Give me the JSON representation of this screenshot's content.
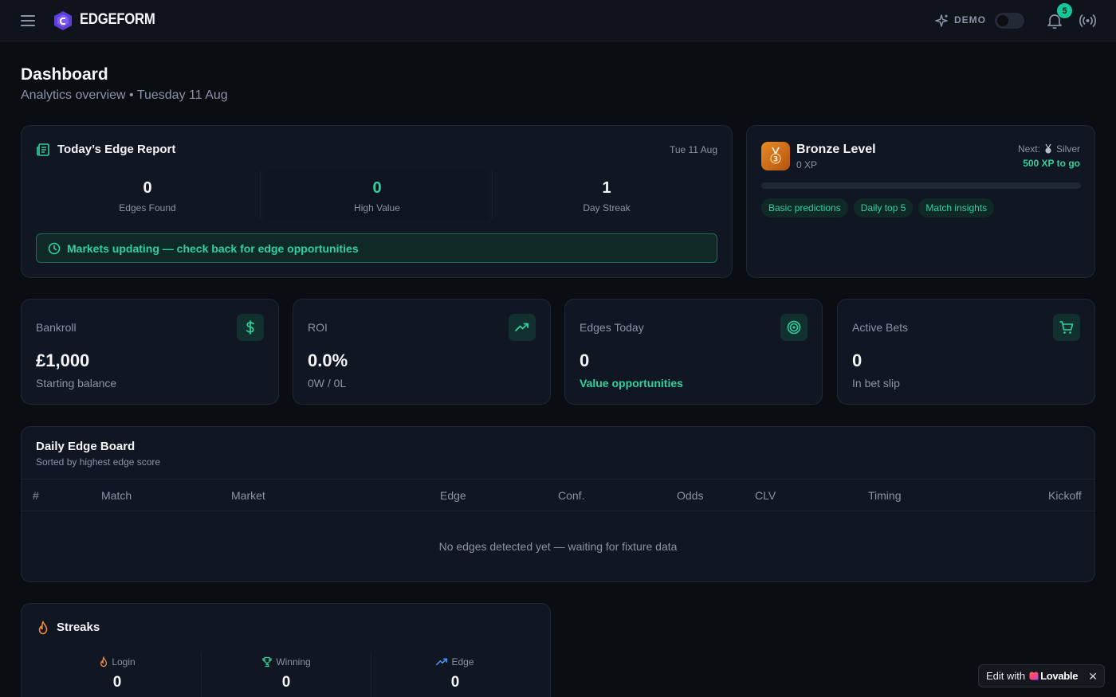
{
  "app": {
    "brand": "EDGEFORM",
    "demo_label": "DEMO",
    "notification_count": "5"
  },
  "header": {
    "title": "Dashboard",
    "subtitle": "Analytics overview • Tuesday 11 Aug"
  },
  "edge_report": {
    "title": "Today’s Edge Report",
    "date": "Tue 11 Aug",
    "stats": [
      {
        "value": "0",
        "label": "Edges Found"
      },
      {
        "value": "0",
        "label": "High Value"
      },
      {
        "value": "1",
        "label": "Day Streak"
      }
    ],
    "banner": "Markets updating — check back for edge opportunities"
  },
  "level": {
    "title": "Bronze Level",
    "xp": "0 XP",
    "next_label": "Next:",
    "next_name": "Silver",
    "to_go": "500 XP to go",
    "progress_fraction": 0,
    "perks": [
      "Basic predictions",
      "Daily top 5",
      "Match insights"
    ]
  },
  "stats": [
    {
      "label": "Bankroll",
      "value": "£1,000",
      "sub": "Starting balance",
      "icon": "dollar-icon"
    },
    {
      "label": "ROI",
      "value": "0.0%",
      "sub": "0W / 0L",
      "icon": "trending-up-icon"
    },
    {
      "label": "Edges Today",
      "value": "0",
      "sub": "Value opportunities",
      "icon": "target-icon"
    },
    {
      "label": "Active Bets",
      "value": "0",
      "sub": "In bet slip",
      "icon": "cart-icon"
    }
  ],
  "board": {
    "title": "Daily Edge Board",
    "subtitle": "Sorted by highest edge score",
    "columns": [
      "#",
      "Match",
      "Market",
      "Edge",
      "Conf.",
      "Odds",
      "CLV",
      "Timing",
      "Kickoff"
    ],
    "empty": "No edges detected yet — waiting for fixture data"
  },
  "streaks": {
    "title": "Streaks",
    "items": [
      {
        "label": "Login",
        "value": "0"
      },
      {
        "label": "Winning",
        "value": "0"
      },
      {
        "label": "Edge",
        "value": "0"
      }
    ]
  },
  "lovable": {
    "edit": "Edit with",
    "brand": "Lovable",
    "close": "✕"
  },
  "colors": {
    "accent": "#2fd19d",
    "background": "#0a0d12",
    "card": "#111722",
    "bronze": "#e98a24"
  }
}
